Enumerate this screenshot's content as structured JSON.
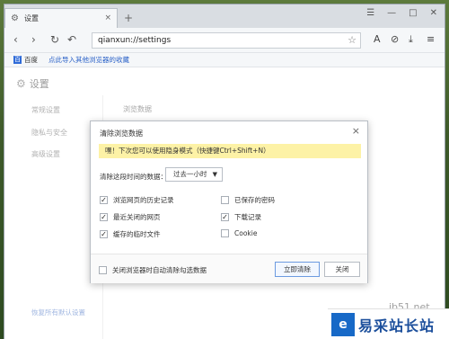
{
  "window": {
    "tab_title": "设置",
    "tab_close": "×",
    "new_tab": "+",
    "win_buttons": [
      "☰",
      "—",
      "□",
      "✕"
    ]
  },
  "toolbar": {
    "address": "qianxun://settings",
    "nav": {
      "back": "‹",
      "forward": "›",
      "reload": "↻",
      "undo": "↶"
    },
    "right_icons": [
      "A",
      "⊘",
      "⤓",
      "≡"
    ]
  },
  "bookmarks": {
    "item": "百度",
    "import_link": "点此导入其他浏览器的收藏"
  },
  "settings": {
    "header": "设置",
    "sidebar": [
      "常规设置",
      "隐私与安全",
      "高级设置"
    ],
    "reset_link": "恢复所有默认设置",
    "content_title": "浏览数据"
  },
  "dialog": {
    "title": "清除浏览数据",
    "close": "×",
    "notice": "嘿！下次您可以使用隐身模式（快捷键Ctrl+Shift+N）",
    "range_label": "清除这段时间的数据：",
    "range_value": "过去一小时",
    "options": [
      {
        "label": "浏览网页的历史记录",
        "checked": true
      },
      {
        "label": "已保存的密码",
        "checked": false
      },
      {
        "label": "最近关闭的网页",
        "checked": true
      },
      {
        "label": "下载记录",
        "checked": true
      },
      {
        "label": "缓存的临时文件",
        "checked": true
      },
      {
        "label": "Cookie",
        "checked": false
      }
    ],
    "auto_clear_label": "关闭浏览器时自动清除勾选数据",
    "auto_clear_checked": false,
    "confirm_button": "立即清除",
    "close_button": "关闭"
  },
  "watermark": {
    "url": "jb51.net",
    "logo_text": "易采站长站"
  }
}
